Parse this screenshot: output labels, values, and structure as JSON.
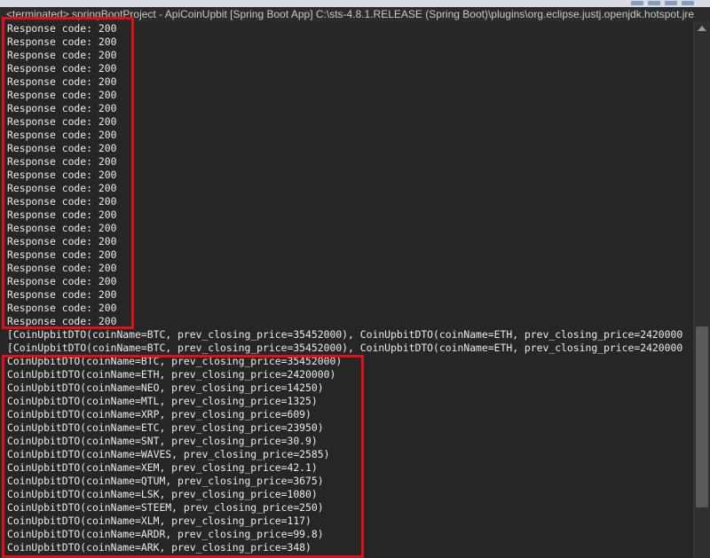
{
  "window": {
    "title": "<terminated> springBootProject - ApiCoinUpbit [Spring Boot App] C:\\sts-4.8.1.RELEASE (Spring Boot)\\plugins\\org.eclipse.justj.openjdk.hotspot.jre"
  },
  "console": {
    "lines": [
      "Response code: 200",
      "Response code: 200",
      "Response code: 200",
      "Response code: 200",
      "Response code: 200",
      "Response code: 200",
      "Response code: 200",
      "Response code: 200",
      "Response code: 200",
      "Response code: 200",
      "Response code: 200",
      "Response code: 200",
      "Response code: 200",
      "Response code: 200",
      "Response code: 200",
      "Response code: 200",
      "Response code: 200",
      "Response code: 200",
      "Response code: 200",
      "Response code: 200",
      "Response code: 200",
      "Response code: 200",
      "Response code: 200",
      "[CoinUpbitDTO(coinName=BTC, prev_closing_price=35452000), CoinUpbitDTO(coinName=ETH, prev_closing_price=2420000",
      "[CoinUpbitDTO(coinName=BTC, prev_closing_price=35452000), CoinUpbitDTO(coinName=ETH, prev_closing_price=2420000",
      "CoinUpbitDTO(coinName=BTC, prev_closing_price=35452000)",
      "CoinUpbitDTO(coinName=ETH, prev_closing_price=2420000)",
      "CoinUpbitDTO(coinName=NEO, prev_closing_price=14250)",
      "CoinUpbitDTO(coinName=MTL, prev_closing_price=1325)",
      "CoinUpbitDTO(coinName=XRP, prev_closing_price=609)",
      "CoinUpbitDTO(coinName=ETC, prev_closing_price=23950)",
      "CoinUpbitDTO(coinName=SNT, prev_closing_price=30.9)",
      "CoinUpbitDTO(coinName=WAVES, prev_closing_price=2585)",
      "CoinUpbitDTO(coinName=XEM, prev_closing_price=42.1)",
      "CoinUpbitDTO(coinName=QTUM, prev_closing_price=3675)",
      "CoinUpbitDTO(coinName=LSK, prev_closing_price=1080)",
      "CoinUpbitDTO(coinName=STEEM, prev_closing_price=250)",
      "CoinUpbitDTO(coinName=XLM, prev_closing_price=117)",
      "CoinUpbitDTO(coinName=ARDR, prev_closing_price=99.8)",
      "CoinUpbitDTO(coinName=ARK, prev_closing_price=348)"
    ]
  },
  "colors": {
    "background": "#262626",
    "text": "#ebebeb",
    "highlight": "#e0101a"
  }
}
